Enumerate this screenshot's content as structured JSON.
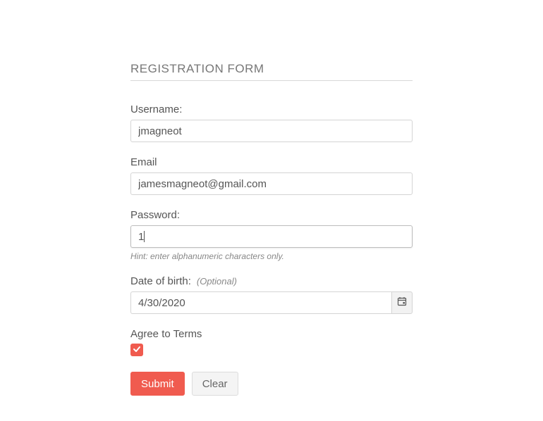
{
  "form": {
    "title": "REGISTRATION FORM",
    "username": {
      "label": "Username:",
      "value": "jmagneot"
    },
    "email": {
      "label": "Email",
      "value": "jamesmagneot@gmail.com"
    },
    "password": {
      "label": "Password:",
      "value": "1",
      "hint": "Hint: enter alphanumeric characters only."
    },
    "dob": {
      "label": "Date of birth:",
      "optional": "(Optional)",
      "value": "4/30/2020"
    },
    "terms": {
      "label": "Agree to Terms",
      "checked": true
    },
    "buttons": {
      "submit": "Submit",
      "clear": "Clear"
    },
    "colors": {
      "primary": "#f05b4f"
    }
  }
}
